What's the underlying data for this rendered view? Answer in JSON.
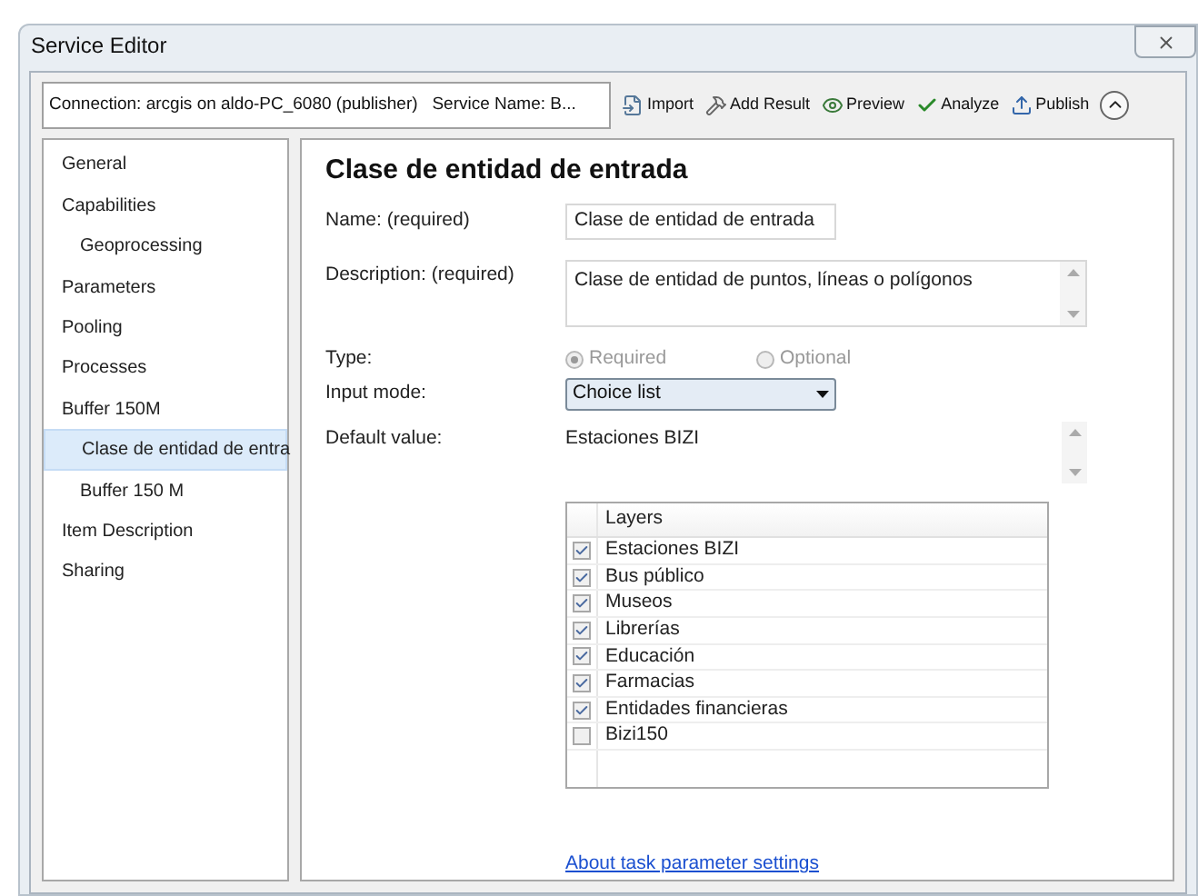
{
  "window": {
    "title": "Service Editor"
  },
  "connection": "Connection: arcgis on aldo-PC_6080 (publisher)   Service Name: B...",
  "toolbar": [
    "Import",
    "Add Result",
    "Preview",
    "Analyze",
    "Publish"
  ],
  "sidebar": {
    "items": [
      {
        "label": "General",
        "selected": false
      },
      {
        "label": "Capabilities",
        "selected": false,
        "children": [
          {
            "label": "Geoprocessing",
            "selected": false
          }
        ]
      },
      {
        "label": "Parameters",
        "selected": false
      },
      {
        "label": "Pooling",
        "selected": false
      },
      {
        "label": "Processes",
        "selected": false
      },
      {
        "label": "Buffer 150M",
        "selected": false,
        "children": [
          {
            "label": "Clase de entidad de entra",
            "selected": true
          },
          {
            "label": "Buffer 150 M",
            "selected": false
          }
        ]
      },
      {
        "label": "Item Description",
        "selected": false
      },
      {
        "label": "Sharing",
        "selected": false
      }
    ]
  },
  "panel": {
    "heading": "Clase de entidad de entrada",
    "name": {
      "label": "Name:  (required)",
      "value": "Clase de entidad de entrada"
    },
    "description": {
      "label": "Description:  (required)",
      "value": "Clase de entidad de puntos, líneas o polígonos"
    },
    "type": {
      "label": "Type:",
      "options": [
        {
          "label": "Required",
          "selected": true,
          "disabled": true
        },
        {
          "label": "Optional",
          "selected": false,
          "disabled": true
        }
      ]
    },
    "input_mode": {
      "label": "Input mode:",
      "value": "Choice list"
    },
    "default_value": {
      "label": "Default value:",
      "value": "Estaciones BIZI"
    },
    "layers": {
      "header": "Layers",
      "rows": [
        {
          "label": "Estaciones BIZI",
          "checked": true
        },
        {
          "label": "Bus público",
          "checked": true
        },
        {
          "label": "Museos",
          "checked": true
        },
        {
          "label": "Librerías",
          "checked": true
        },
        {
          "label": "Educación",
          "checked": true
        },
        {
          "label": "Farmacias",
          "checked": true
        },
        {
          "label": "Entidades financieras",
          "checked": true
        },
        {
          "label": "Bizi150",
          "checked": false
        }
      ]
    },
    "link": "About task parameter settings"
  }
}
